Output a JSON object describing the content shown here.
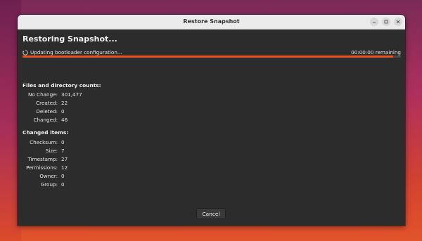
{
  "window": {
    "title": "Restore Snapshot"
  },
  "main": {
    "heading": "Restoring Snapshot...",
    "status": "Updating bootloader configuration...",
    "remaining": "00:00:00 remaining",
    "progress": 0.98
  },
  "counts": {
    "title": "Files and directory counts:",
    "rows": [
      {
        "label": "No Change:",
        "value": "301,477"
      },
      {
        "label": "Created:",
        "value": "22"
      },
      {
        "label": "Deleted:",
        "value": "0"
      },
      {
        "label": "Changed:",
        "value": "46"
      }
    ]
  },
  "changed": {
    "title": "Changed items:",
    "rows": [
      {
        "label": "Checksum:",
        "value": "0"
      },
      {
        "label": "Size:",
        "value": "7"
      },
      {
        "label": "Timestamp:",
        "value": "27"
      },
      {
        "label": "Permissions:",
        "value": "12"
      },
      {
        "label": "Owner:",
        "value": "0"
      },
      {
        "label": "Group:",
        "value": "0"
      }
    ]
  },
  "footer": {
    "cancel_label": "Cancel"
  },
  "colors": {
    "accent": "#e95420",
    "window_bg": "#2c2c2c",
    "titlebar_bg": "#ebebeb"
  },
  "icons": {
    "spinner": "spinner-icon",
    "minimize": "minimize-icon",
    "maximize": "maximize-icon",
    "close": "close-icon"
  }
}
